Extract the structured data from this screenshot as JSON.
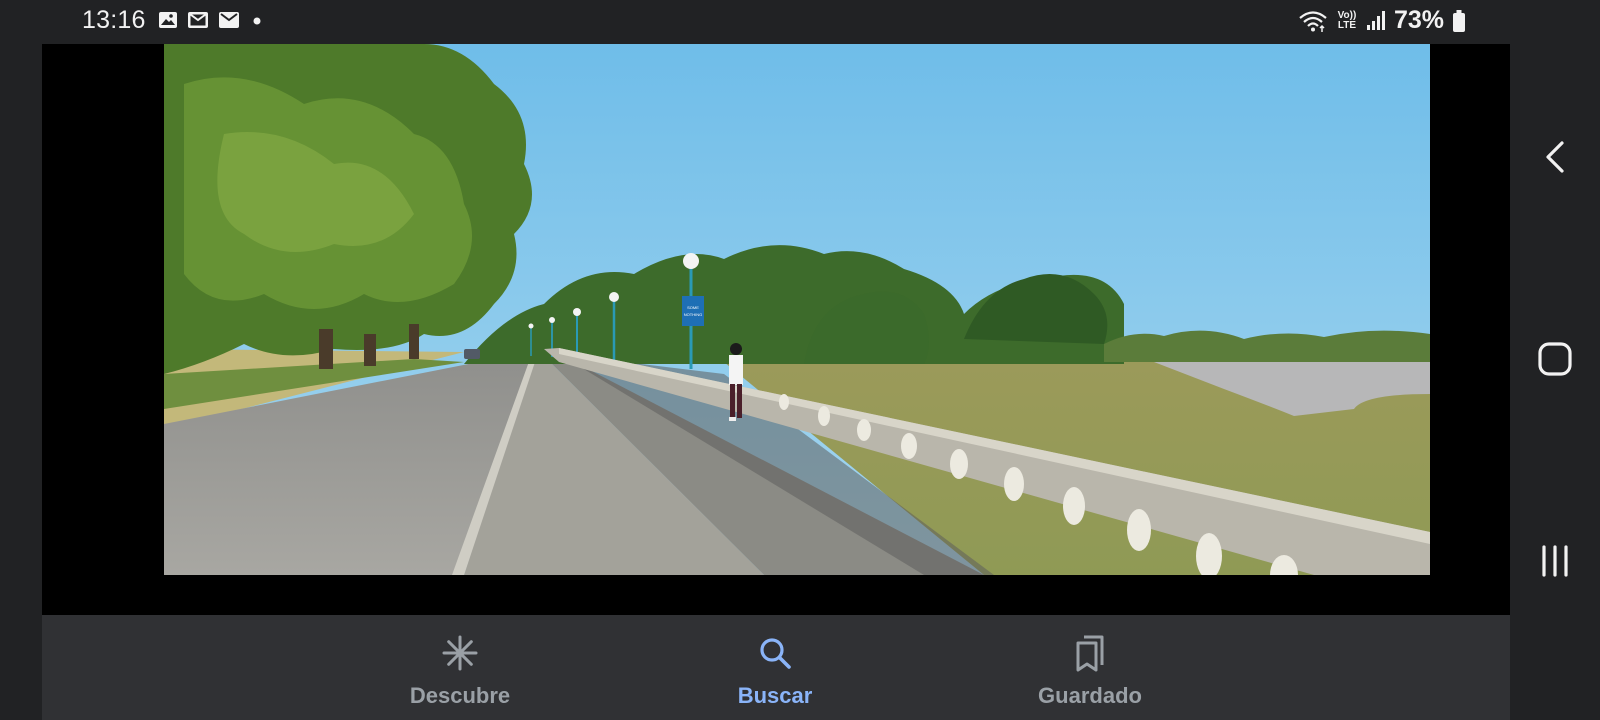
{
  "status_bar": {
    "time": "13:16",
    "lte_top": "Vo))",
    "lte_bottom": "LTE",
    "battery": "73%"
  },
  "photo": {
    "sign_text_1": "SOME",
    "sign_text_2": "NOTHING"
  },
  "bottom_nav": {
    "items": [
      {
        "label": "Descubre",
        "icon": "asterisk-icon",
        "active": false
      },
      {
        "label": "Buscar",
        "icon": "search-icon",
        "active": true
      },
      {
        "label": "Guardado",
        "icon": "bookmarks-icon",
        "active": false
      }
    ]
  },
  "colors": {
    "background": "#212224",
    "nav_bg": "#303134",
    "active": "#8ab4f8",
    "inactive": "#9aa0a6"
  }
}
